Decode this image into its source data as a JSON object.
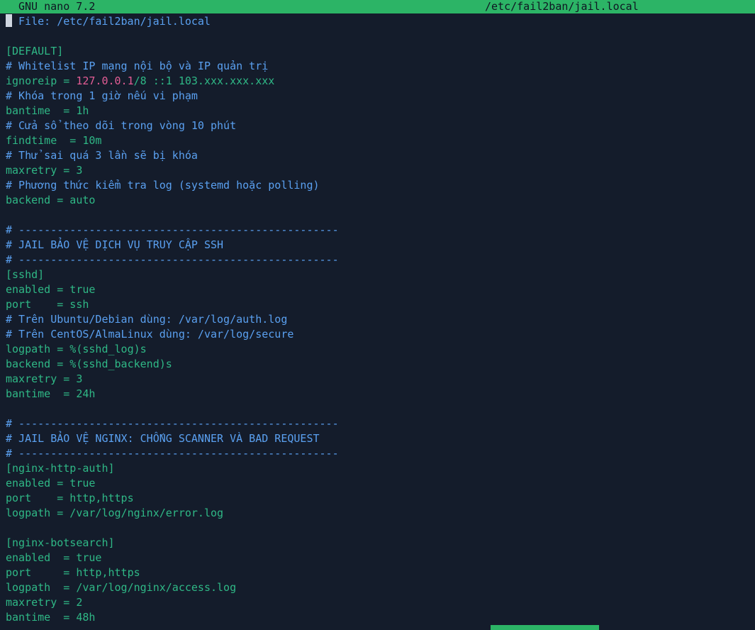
{
  "titlebar": {
    "app": "GNU nano 7.2",
    "filename": "/etc/fail2ban/jail.local"
  },
  "lines": [
    {
      "type": "comment",
      "text": " File: /etc/fail2ban/jail.local"
    },
    {
      "type": "blank",
      "text": ""
    },
    {
      "type": "section",
      "text": "[DEFAULT]"
    },
    {
      "type": "comment",
      "text": "# Whitelist IP mạng nội bộ và IP quản trị"
    },
    {
      "type": "ignoreip",
      "key": "ignoreip = ",
      "ip": "127.0.0.1",
      "rest": "/8 ::1 103.xxx.xxx.xxx"
    },
    {
      "type": "comment",
      "text": "# Khóa trong 1 giờ nếu vi phạm"
    },
    {
      "type": "kv",
      "text": "bantime  = 1h"
    },
    {
      "type": "comment",
      "text": "# Cửa sổ theo dõi trong vòng 10 phút"
    },
    {
      "type": "kv",
      "text": "findtime  = 10m"
    },
    {
      "type": "comment",
      "text": "# Thử sai quá 3 lần sẽ bị khóa"
    },
    {
      "type": "kv",
      "text": "maxretry = 3"
    },
    {
      "type": "comment",
      "text": "# Phương thức kiểm tra log (systemd hoặc polling)"
    },
    {
      "type": "kv",
      "text": "backend = auto"
    },
    {
      "type": "blank",
      "text": ""
    },
    {
      "type": "comment",
      "text": "# --------------------------------------------------"
    },
    {
      "type": "comment",
      "text": "# JAIL BẢO VỆ DỊCH VỤ TRUY CẬP SSH"
    },
    {
      "type": "comment",
      "text": "# --------------------------------------------------"
    },
    {
      "type": "section",
      "text": "[sshd]"
    },
    {
      "type": "kv",
      "text": "enabled = true"
    },
    {
      "type": "kv",
      "text": "port    = ssh"
    },
    {
      "type": "comment",
      "text": "# Trên Ubuntu/Debian dùng: /var/log/auth.log"
    },
    {
      "type": "comment",
      "text": "# Trên CentOS/AlmaLinux dùng: /var/log/secure"
    },
    {
      "type": "kv",
      "text": "logpath = %(sshd_log)s"
    },
    {
      "type": "kv",
      "text": "backend = %(sshd_backend)s"
    },
    {
      "type": "kv",
      "text": "maxretry = 3"
    },
    {
      "type": "kv",
      "text": "bantime  = 24h"
    },
    {
      "type": "blank",
      "text": ""
    },
    {
      "type": "comment",
      "text": "# --------------------------------------------------"
    },
    {
      "type": "comment",
      "text": "# JAIL BẢO VỆ NGINX: CHỐNG SCANNER VÀ BAD REQUEST"
    },
    {
      "type": "comment",
      "text": "# --------------------------------------------------"
    },
    {
      "type": "section",
      "text": "[nginx-http-auth]"
    },
    {
      "type": "kv",
      "text": "enabled = true"
    },
    {
      "type": "kv",
      "text": "port    = http,https"
    },
    {
      "type": "kv",
      "text": "logpath = /var/log/nginx/error.log"
    },
    {
      "type": "blank",
      "text": ""
    },
    {
      "type": "section",
      "text": "[nginx-botsearch]"
    },
    {
      "type": "kv",
      "text": "enabled  = true"
    },
    {
      "type": "kv",
      "text": "port     = http,https"
    },
    {
      "type": "kv",
      "text": "logpath  = /var/log/nginx/access.log"
    },
    {
      "type": "kv",
      "text": "maxretry = 2"
    },
    {
      "type": "kv",
      "text": "bantime  = 48h"
    }
  ],
  "colors": {
    "background": "#141c2b",
    "titlebar": "#2cb466",
    "comment": "#5aa0f0",
    "keyword": "#2fb886",
    "ip": "#e35d95"
  }
}
